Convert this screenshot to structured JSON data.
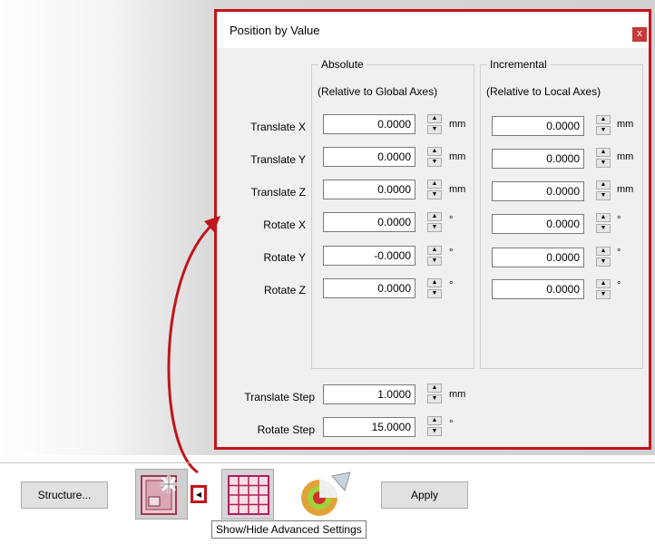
{
  "dialog": {
    "title": "Position by Value",
    "close_glyph": "x",
    "absolute": {
      "title": "Absolute",
      "subtitle": "(Relative to Global Axes)"
    },
    "incremental": {
      "title": "Incremental",
      "subtitle": "(Relative to Local Axes)"
    },
    "rows": [
      {
        "label": "Translate X",
        "abs": "0.0000",
        "inc": "0.0000",
        "unit": "mm"
      },
      {
        "label": "Translate Y",
        "abs": "0.0000",
        "inc": "0.0000",
        "unit": "mm"
      },
      {
        "label": "Translate Z",
        "abs": "0.0000",
        "inc": "0.0000",
        "unit": "mm"
      },
      {
        "label": "Rotate X",
        "abs": "0.0000",
        "inc": "0.0000",
        "unit": "°"
      },
      {
        "label": "Rotate Y",
        "abs": "-0.0000",
        "inc": "0.0000",
        "unit": "°"
      },
      {
        "label": "Rotate Z",
        "abs": "0.0000",
        "inc": "0.0000",
        "unit": "°"
      }
    ],
    "translate_step": {
      "label": "Translate Step",
      "value": "1.0000",
      "unit": "mm"
    },
    "rotate_step": {
      "label": "Rotate Step",
      "value": "15.0000",
      "unit": "°"
    }
  },
  "toolbar": {
    "structure_label": "Structure...",
    "apply_label": "Apply",
    "toggle_glyph": "◂",
    "tooltip": "Show/Hide Advanced Settings"
  },
  "colors": {
    "highlight": "#c0151b"
  },
  "icons": [
    "snowflake-structure-icon",
    "grid-icon",
    "sphere-section-icon"
  ]
}
